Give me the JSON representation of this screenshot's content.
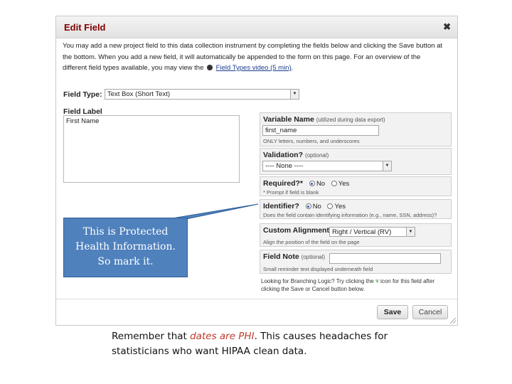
{
  "dialog": {
    "title": "Edit Field",
    "close_glyph": "✖",
    "intro_before": "You may add a new project field to this data collection instrument by completing the fields below and clicking the Save button at the bottom. When you add a new field, it will automatically be appended to the form on this page. For an overview of the different field types available, you may view the",
    "intro_link": "Field Types video (5 min)",
    "intro_after": ".",
    "field_type": {
      "label": "Field Type:",
      "value": "Text Box (Short Text)"
    },
    "field_label": {
      "label": "Field Label",
      "value": "First Name"
    },
    "variable_name": {
      "label": "Variable Name",
      "hint": "(utilized during data export)",
      "value": "first_name",
      "note": "ONLY letters, numbers, and underscores"
    },
    "validation": {
      "label": "Validation?",
      "optional": "(optional)",
      "value": "---- None ----"
    },
    "required": {
      "label": "Required?*",
      "options": [
        "No",
        "Yes"
      ],
      "selected": "No",
      "note": "* Prompt if field is blank"
    },
    "identifier": {
      "label": "Identifier?",
      "options": [
        "No",
        "Yes"
      ],
      "selected": "No",
      "note": "Does the field contain identifying information (e.g., name, SSN, address)?"
    },
    "custom_alignment": {
      "label": "Custom Alignment",
      "value": "Right / Vertical (RV)",
      "note": "Align the position of the field on the page"
    },
    "field_note": {
      "label": "Field Note",
      "optional": "(optional)",
      "value": "",
      "note": "Small reminder text displayed underneath field"
    },
    "branching_before": "Looking for Branching Logic? Try clicking the",
    "branching_after": "icon for this field after clicking the Save or Cancel button below.",
    "buttons": {
      "save": "Save",
      "cancel": "Cancel"
    }
  },
  "callout": {
    "line1": "This is Protected",
    "line2": "Health Information.",
    "line3": "So mark it."
  },
  "caption": {
    "part1": "Remember that ",
    "emphasis": "dates are PHI",
    "part2": ".  This causes headaches for statisticians who want HIPAA clean data."
  },
  "colors": {
    "title": "#800000",
    "callout": "#4f81bd",
    "emphasis": "#c0392b"
  }
}
